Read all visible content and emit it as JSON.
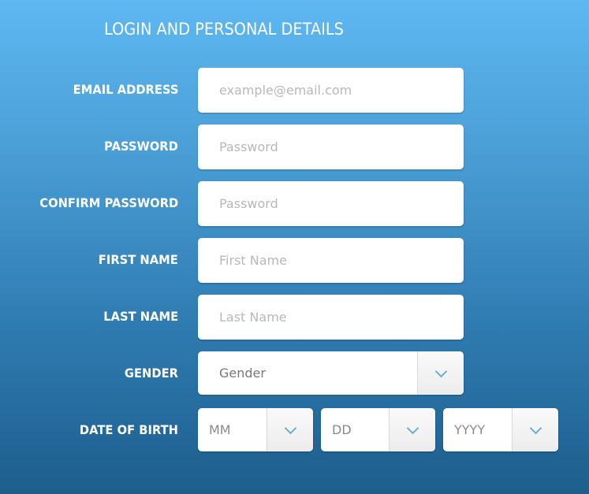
{
  "title": "LOGIN AND PERSONAL DETAILS",
  "fields": {
    "email": {
      "label": "EMAIL ADDRESS",
      "placeholder": "example@email.com",
      "value": ""
    },
    "password": {
      "label": "PASSWORD",
      "placeholder": "Password",
      "value": ""
    },
    "confirm_password": {
      "label": "CONFIRM PASSWORD",
      "placeholder": "Password",
      "value": ""
    },
    "first_name": {
      "label": "FIRST NAME",
      "placeholder": "First Name",
      "value": ""
    },
    "last_name": {
      "label": "LAST NAME",
      "placeholder": "Last Name",
      "value": ""
    },
    "gender": {
      "label": "GENDER",
      "selected": "Gender"
    },
    "dob": {
      "label": "DATE OF BIRTH",
      "month": "MM",
      "day": "DD",
      "year": "YYYY"
    }
  },
  "icons": {
    "dropdown": "chevron-down-icon"
  }
}
